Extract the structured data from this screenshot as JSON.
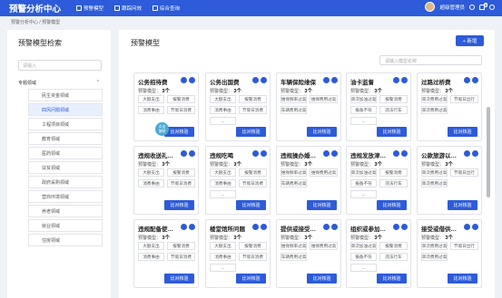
{
  "topbar": {
    "logo": "预警分析中心",
    "nav": [
      {
        "label": "预警模型"
      },
      {
        "label": "跟踪问效"
      },
      {
        "label": "综合查询"
      }
    ],
    "user": "超级管理员",
    "badge": "8"
  },
  "breadcrumb": "预警分析中心 / 预警模型",
  "left": {
    "title": "预警模型检索",
    "search_placeholder": "请输入",
    "group": "专题领域",
    "items": [
      "民生资金领域",
      "四风问题领域",
      "工程项目领域",
      "教育领域",
      "医药领域",
      "扶贫领域",
      "政府采购领域",
      "营商环境领域",
      "养老领域",
      "就业领域",
      "住房领域"
    ],
    "active_index": 1
  },
  "main": {
    "title": "预警模型",
    "add_label": "+ 新增",
    "search_placeholder": "请输入模型名称",
    "compare_label": "比对核验",
    "count_label": "预警模型：",
    "cards": [
      {
        "title": "公务招待费",
        "count": "3个",
        "tags": [
          [
            "大额支出",
            "报警消费"
          ],
          [
            "消费事由",
            "节假日消费"
          ],
          [
            "",
            ""
          ]
        ]
      },
      {
        "title": "公务出国费",
        "count": "3个",
        "tags": [
          [
            "大额支出",
            "报警消费"
          ],
          [
            "消费事由",
            "节假日消费"
          ],
          [
            "...",
            ""
          ]
        ]
      },
      {
        "title": "车辆保险维保",
        "count": "3个",
        "tags": [
          [
            "维保频率过高",
            "维保费用过高"
          ],
          [
            "车辆费用过高",
            ""
          ],
          [
            "",
            ""
          ]
        ]
      },
      {
        "title": "油卡监督",
        "count": "3个",
        "tags": [
          [
            "单次加油过高",
            "报警消费"
          ],
          [
            "报备不符",
            "违法行车"
          ],
          [
            "...",
            ""
          ]
        ]
      },
      {
        "title": "过路过桥费",
        "count": "3个",
        "tags": [
          [
            "单次费用过高",
            "节假日出行"
          ],
          [
            "单次费用过高",
            ""
          ],
          [
            "",
            ""
          ]
        ]
      },
      {
        "title": "违规收送礼品...",
        "count": "3个",
        "tags": [
          [
            "大额支出",
            "报警消费"
          ],
          [
            "消费事由",
            "节假日消费"
          ],
          [
            "",
            ""
          ]
        ]
      },
      {
        "title": "违规吃喝",
        "count": "3个",
        "tags": [
          [
            "大额支出",
            "报警消费"
          ],
          [
            "消费事由",
            "节假日消费"
          ],
          [
            "...",
            ""
          ]
        ]
      },
      {
        "title": "违规操办婚丧...",
        "count": "3个",
        "tags": [
          [
            "维保频率过高",
            "维保费用过高"
          ],
          [
            "车辆费用过高",
            ""
          ],
          [
            "",
            ""
          ]
        ]
      },
      {
        "title": "违规发放津贴...",
        "count": "3个",
        "tags": [
          [
            "单次加油过高",
            "报警消费"
          ],
          [
            "报备不符",
            "违法行车"
          ],
          [
            "...",
            ""
          ]
        ]
      },
      {
        "title": "公款旅游以及...",
        "count": "3个",
        "tags": [
          [
            "单次费用过高",
            "节假日出行"
          ],
          [
            "单次费用过高",
            ""
          ],
          [
            "",
            ""
          ]
        ]
      },
      {
        "title": "违规配备使用...",
        "count": "3个",
        "tags": [
          [
            "大额支出",
            "报警消费"
          ],
          [
            "消费事由",
            "节假日消费"
          ],
          [
            "",
            ""
          ]
        ]
      },
      {
        "title": "楼堂馆所问题",
        "count": "3个",
        "tags": [
          [
            "大额支出",
            "报警消费"
          ],
          [
            "消费事由",
            "节假日消费"
          ],
          [
            "...",
            ""
          ]
        ]
      },
      {
        "title": "提供或接受超...",
        "count": "3个",
        "tags": [
          [
            "维保频率过高",
            "维保费用过高"
          ],
          [
            "车辆费用过高",
            ""
          ],
          [
            "",
            ""
          ]
        ]
      },
      {
        "title": "组织或参加用...",
        "count": "3个",
        "tags": [
          [
            "单次加油过高",
            "报警消费"
          ],
          [
            "报备不符",
            "违法行车"
          ],
          [
            "...",
            ""
          ]
        ]
      },
      {
        "title": "接受或借供可...",
        "count": "3个",
        "tags": [
          [
            "单次费用过高",
            "节假日出行"
          ],
          [
            "单次费用过高",
            ""
          ],
          [
            "",
            ""
          ]
        ]
      }
    ]
  },
  "float_label": "点击\n复制"
}
